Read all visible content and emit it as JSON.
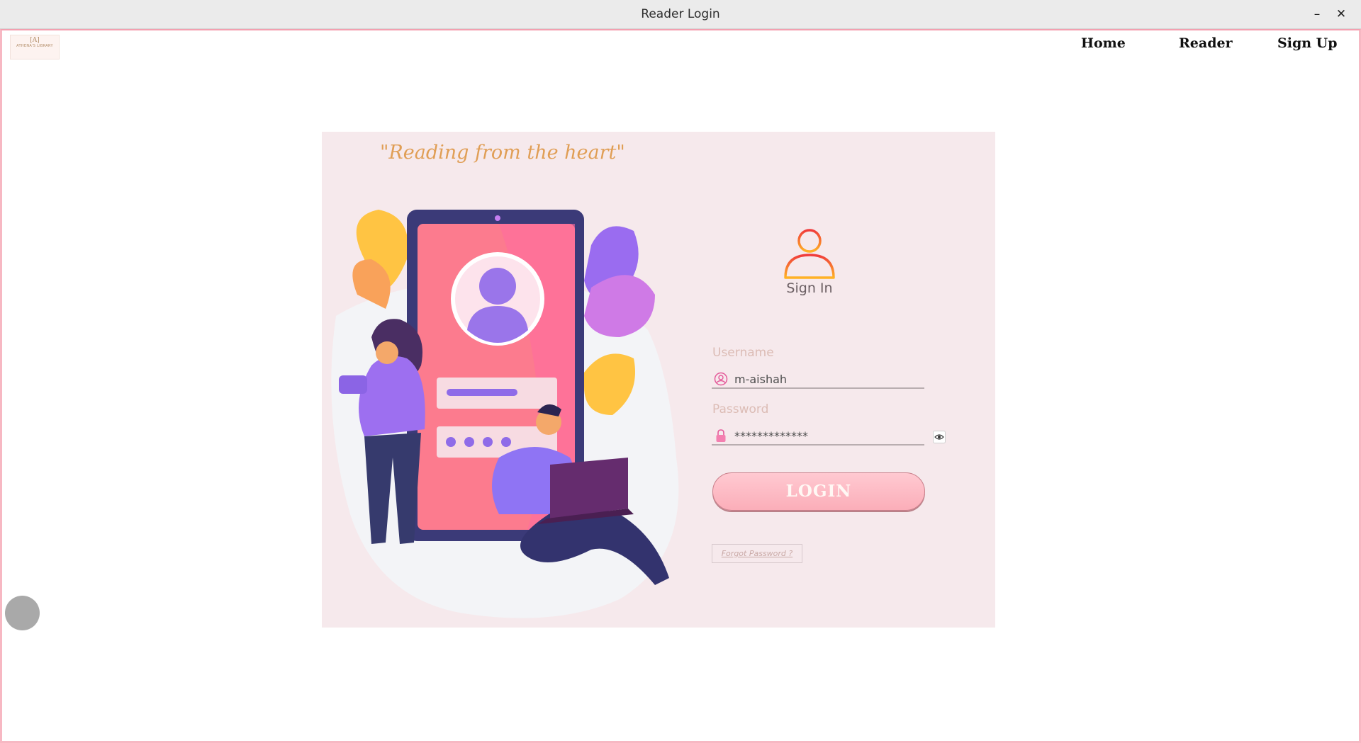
{
  "window": {
    "title": "Reader Login",
    "minimize": "–",
    "close": "✕"
  },
  "logo": {
    "mark": "[A]",
    "text": "ATHENA'S LIBRARY"
  },
  "nav": {
    "home": "Home",
    "reader": "Reader",
    "signup": "Sign Up"
  },
  "panel": {
    "quote": "\"Reading from the heart\"",
    "signin_label": "Sign In",
    "username_label": "Username",
    "username_value": "m-aishah",
    "password_label": "Password",
    "password_value": "*************",
    "login_label": "LOGIN",
    "forgot_label": "Forgot Password ?"
  },
  "icons": {
    "user": "user-icon",
    "lock": "lock-icon",
    "eye": "eye-toggle-icon",
    "signin": "person-icon"
  },
  "colors": {
    "panel_bg": "#f6e9ec",
    "accent": "#e09e55",
    "button": "#fbaeb9",
    "frame": "#f7b8c3"
  }
}
